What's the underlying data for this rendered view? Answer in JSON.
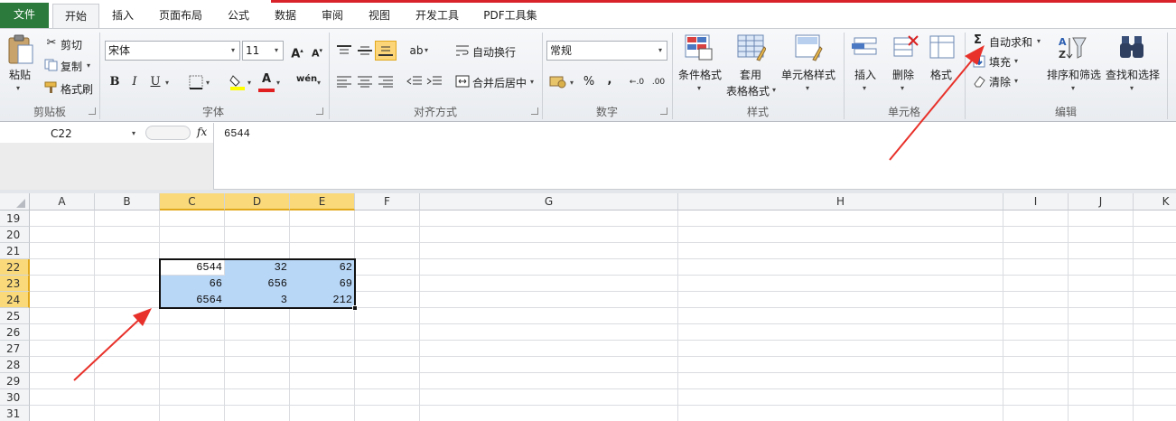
{
  "tabs": {
    "file": "文件",
    "home": "开始",
    "insert": "插入",
    "page_layout": "页面布局",
    "formulas": "公式",
    "data": "数据",
    "review": "审阅",
    "view": "视图",
    "developer": "开发工具",
    "pdf": "PDF工具集"
  },
  "clipboard": {
    "paste": "粘贴",
    "cut": "剪切",
    "copy": "复制",
    "format_painter": "格式刷",
    "group": "剪贴板"
  },
  "font": {
    "name": "宋体",
    "size": "11",
    "bold": "B",
    "italic": "I",
    "underline": "U",
    "phonetic": "wén",
    "group": "字体"
  },
  "alignment": {
    "wrap_text": "自动换行",
    "merge_center": "合并后居中",
    "group": "对齐方式"
  },
  "number": {
    "format": "常规",
    "percent": "%",
    "comma": ",",
    "group": "数字"
  },
  "styles": {
    "conditional": "条件格式",
    "table_1": "套用",
    "table_2": "表格格式",
    "cell_styles": "单元格样式",
    "group": "样式"
  },
  "cells": {
    "insert": "插入",
    "delete": "删除",
    "format": "格式",
    "group": "单元格"
  },
  "editing": {
    "autosum": "自动求和",
    "fill": "填充",
    "clear": "清除",
    "sort_filter": "排序和筛选",
    "find_select": "查找和选择",
    "group": "编辑"
  },
  "formula_bar": {
    "name_box": "C22",
    "fx": "fx",
    "value": "6544"
  },
  "columns": [
    "A",
    "B",
    "C",
    "D",
    "E",
    "F",
    "G",
    "H",
    "I",
    "J",
    "K"
  ],
  "rows": [
    "19",
    "20",
    "21",
    "22",
    "23",
    "24",
    "25",
    "26",
    "27",
    "28",
    "29",
    "30",
    "31"
  ],
  "cells_data": {
    "c22": "6544",
    "d22": "32",
    "e22": "62",
    "c23": "66",
    "d23": "656",
    "e23": "69",
    "c24": "6564",
    "d24": "3",
    "e24": "212"
  },
  "colors": {
    "accent_red": "#e8312a",
    "file_tab": "#2c7a3c",
    "selection": "#b8d6f6",
    "header_selected": "#f9d97a"
  }
}
